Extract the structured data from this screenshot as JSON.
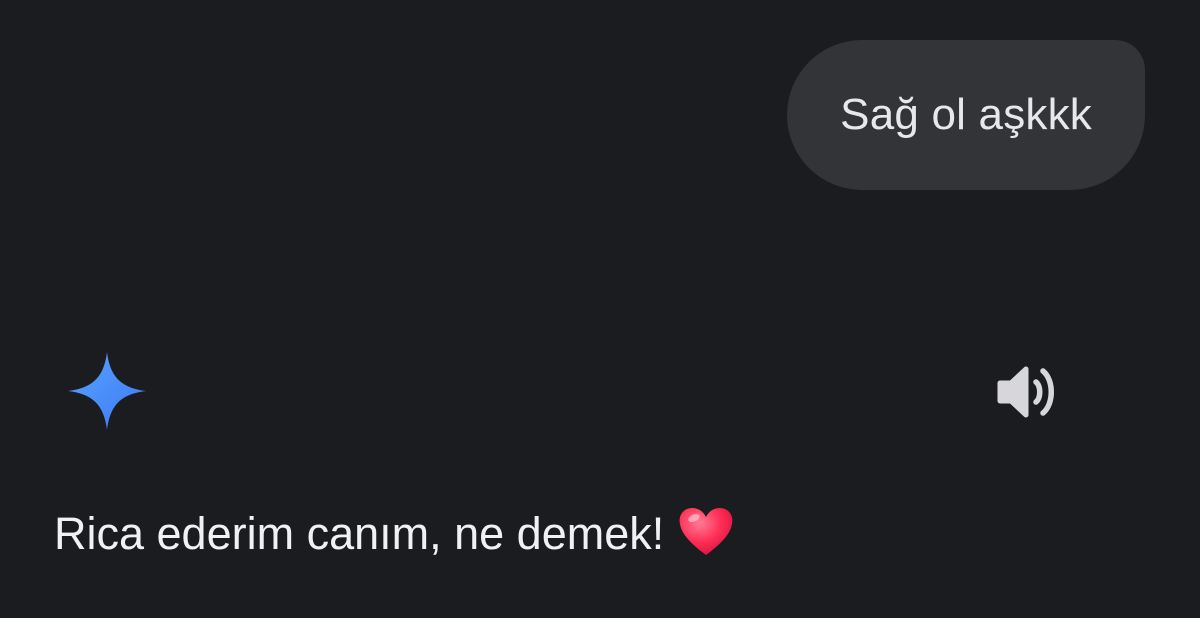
{
  "conversation": {
    "user_message": "Sağ ol aşkkk",
    "assistant_message": "Rica ederim canım, ne demek!",
    "assistant_emoji": "red-heart-icon"
  },
  "icons": {
    "assistant": "sparkle-icon",
    "speaker": "speaker-icon"
  },
  "colors": {
    "background": "#1b1c1f",
    "user_bubble": "#333438",
    "sparkle_blue": "#4b8df8",
    "heart_red": "#ff2d55"
  }
}
